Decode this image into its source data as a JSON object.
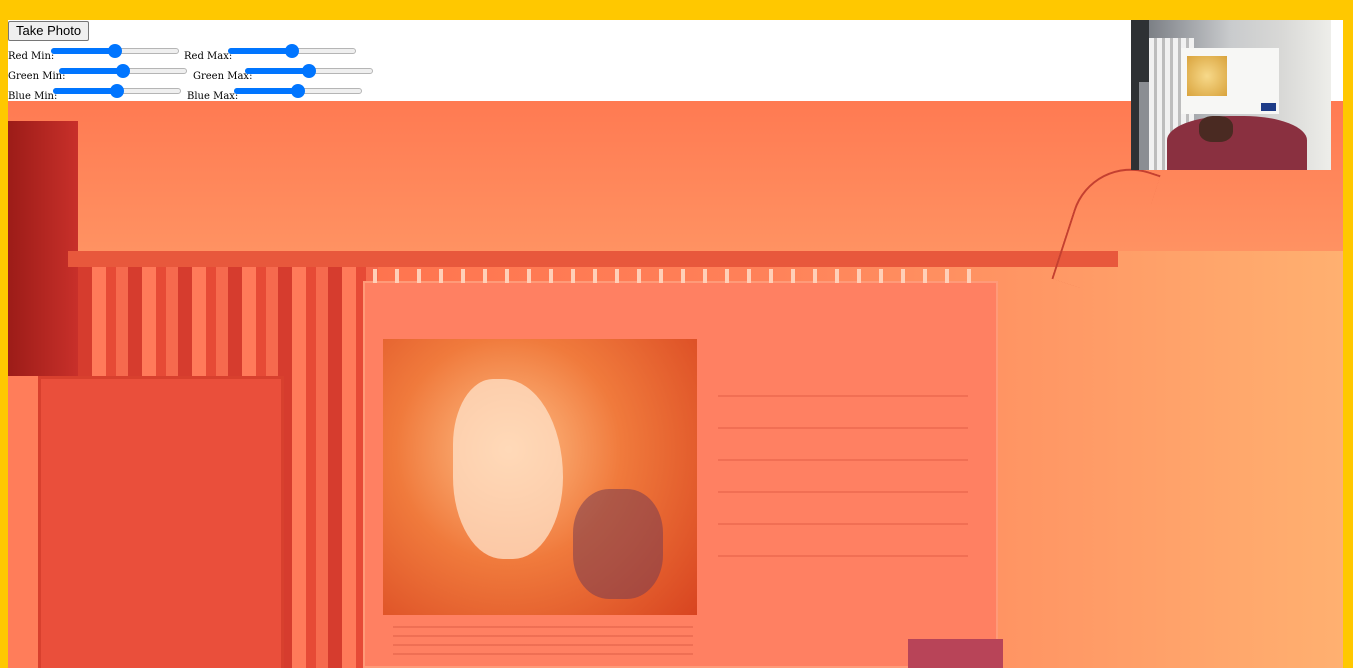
{
  "controls": {
    "take_photo_label": "Take Photo",
    "sliders": [
      {
        "label": "Red Min:",
        "value": 0.5
      },
      {
        "label": "Red Max:",
        "value": 0.5
      },
      {
        "label": "Green Min:",
        "value": 0.5
      },
      {
        "label": "Green Max:",
        "value": 0.5
      },
      {
        "label": "Blue Min:",
        "value": 0.5
      },
      {
        "label": "Blue Max:",
        "value": 0.5
      }
    ]
  },
  "colors": {
    "page_background": "#ffc800",
    "slider_accent": "#0075ff",
    "video_tint": "#ff7a52"
  },
  "icons": {
    "preview": "webcam-preview-thumbnail"
  }
}
